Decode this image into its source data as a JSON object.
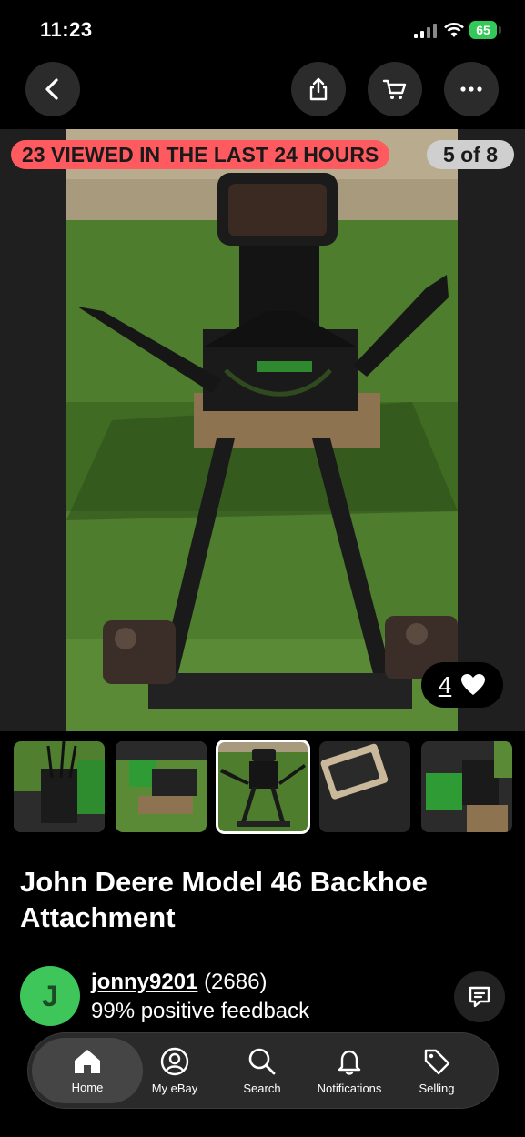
{
  "status_bar": {
    "time": "11:23",
    "battery": "65"
  },
  "photo": {
    "viewed_badge": "23 VIEWED IN THE LAST 24 HOURS",
    "counter": "5 of 8",
    "watchers": "4"
  },
  "listing": {
    "title": "John Deere Model 46 Backhoe Attachment"
  },
  "seller": {
    "initial": "J",
    "username": "jonny9201",
    "score": "(2686)",
    "feedback": "99% positive feedback"
  },
  "tabs": [
    {
      "label": "Home",
      "icon": "home-icon"
    },
    {
      "label": "My eBay",
      "icon": "user-icon"
    },
    {
      "label": "Search",
      "icon": "search-icon"
    },
    {
      "label": "Notifications",
      "icon": "bell-icon"
    },
    {
      "label": "Selling",
      "icon": "tag-icon"
    }
  ],
  "colors": {
    "badge_red": "#ff5a5f",
    "avatar_green": "#3ec65a",
    "battery_green": "#34c759"
  }
}
